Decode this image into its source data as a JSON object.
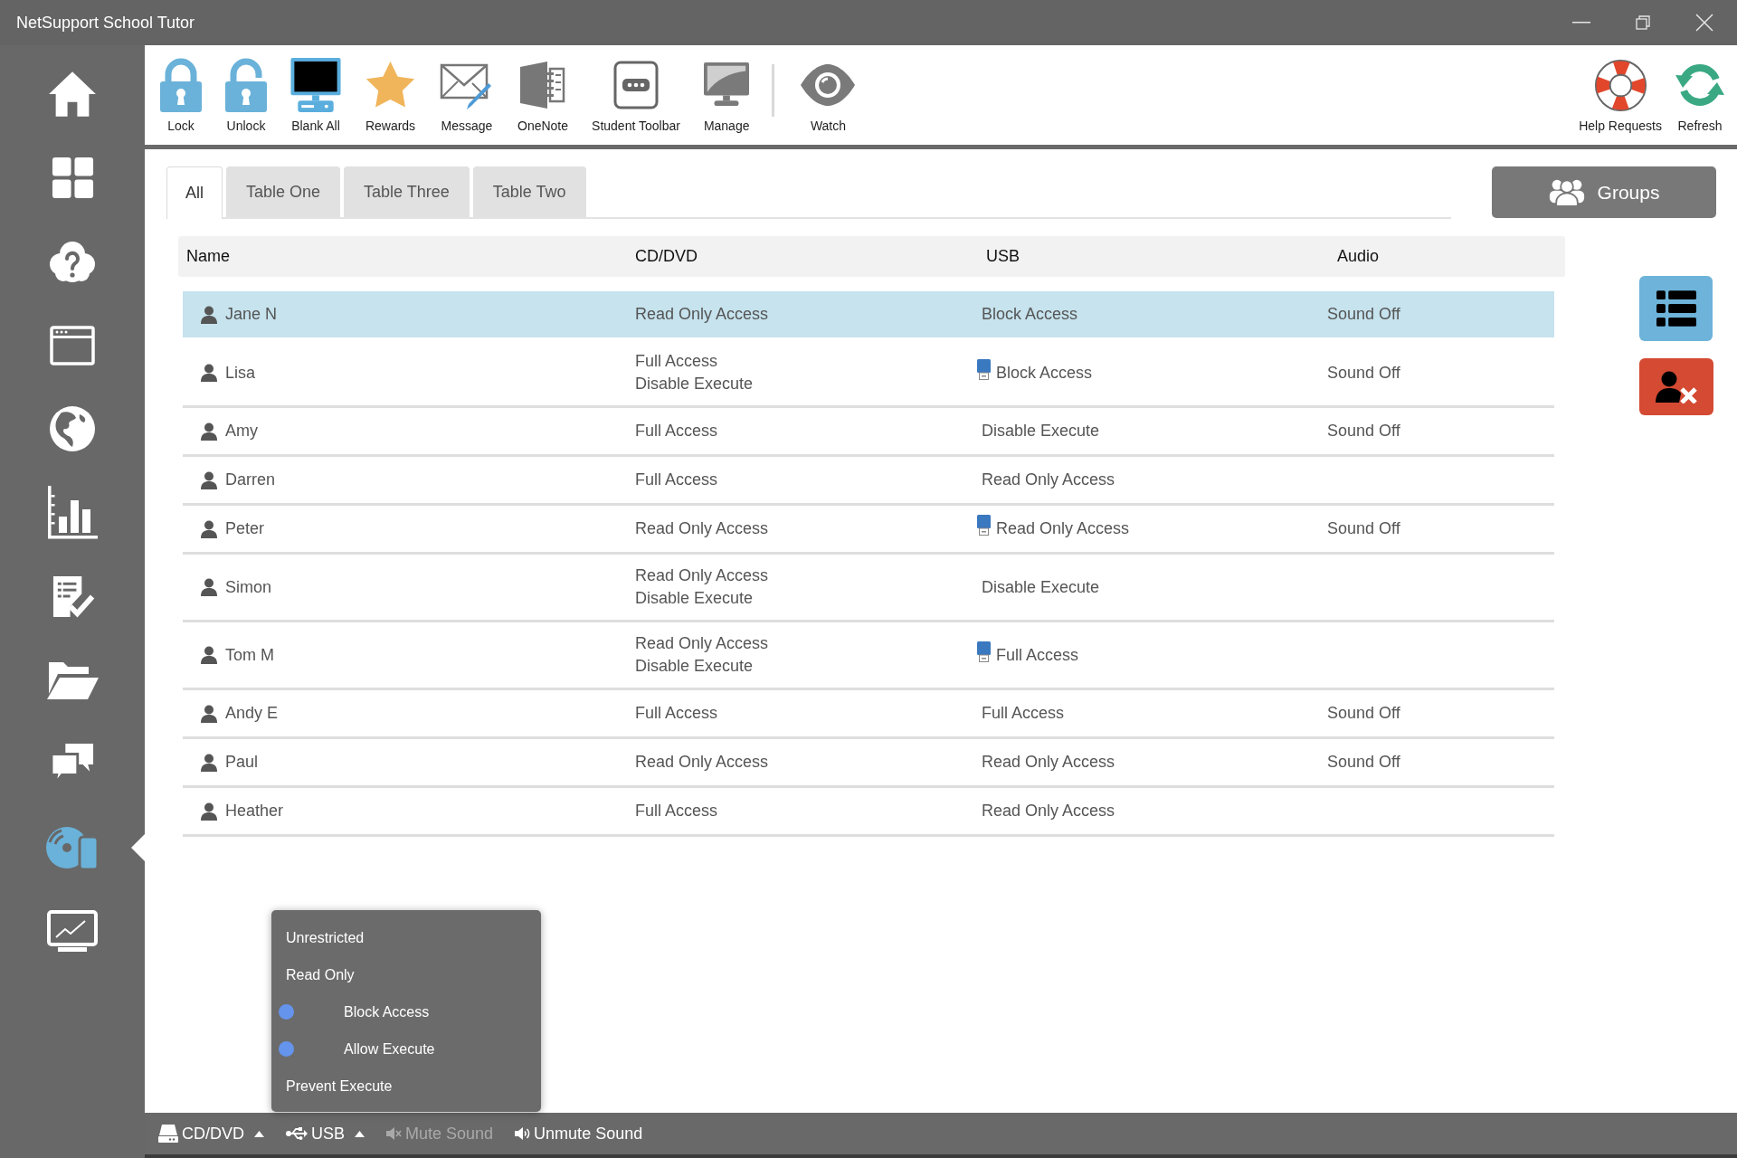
{
  "window": {
    "title": "NetSupport School Tutor"
  },
  "sidebar": {
    "items": [
      {
        "selected": false
      },
      {
        "selected": false
      },
      {
        "selected": false
      },
      {
        "selected": false
      },
      {
        "selected": false
      },
      {
        "selected": false
      },
      {
        "selected": false
      },
      {
        "selected": false
      },
      {
        "selected": false
      },
      {
        "selected": true
      },
      {
        "selected": false
      }
    ]
  },
  "toolbar": {
    "groups": [
      {
        "items": [
          {
            "label": "Lock"
          },
          {
            "label": "Unlock"
          },
          {
            "label": "Blank All"
          },
          {
            "label": "Rewards"
          },
          {
            "label": "Message"
          },
          {
            "label": "OneNote"
          },
          {
            "label": "Student Toolbar"
          },
          {
            "label": "Manage"
          }
        ]
      },
      {
        "items": [
          {
            "label": "Watch"
          }
        ]
      }
    ],
    "right_items": [
      {
        "label": "Help Requests"
      },
      {
        "label": "Refresh"
      }
    ]
  },
  "tabs": [
    {
      "label": "All",
      "selected": true
    },
    {
      "label": "Table One",
      "selected": false
    },
    {
      "label": "Table Three",
      "selected": false
    },
    {
      "label": "Table Two",
      "selected": false
    }
  ],
  "groups_button": {
    "label": "Groups"
  },
  "table": {
    "columns": [
      "Name",
      "CD/DVD",
      "USB",
      "Audio"
    ],
    "rows": [
      {
        "name": "Jane N",
        "selected": true,
        "cd_dvd": [
          "Read Only Access"
        ],
        "usb": "Block Access",
        "usb_device": false,
        "audio": "Sound Off"
      },
      {
        "name": "Lisa",
        "selected": false,
        "cd_dvd": [
          "Full Access",
          "Disable Execute"
        ],
        "usb": "Block Access",
        "usb_device": true,
        "audio": "Sound Off"
      },
      {
        "name": "Amy",
        "selected": false,
        "cd_dvd": [
          "Full Access"
        ],
        "usb": "Disable Execute",
        "usb_device": false,
        "audio": "Sound Off"
      },
      {
        "name": "Darren",
        "selected": false,
        "cd_dvd": [
          "Full Access"
        ],
        "usb": "Read Only Access",
        "usb_device": false
      },
      {
        "name": "Peter",
        "selected": false,
        "cd_dvd": [
          "Read Only Access"
        ],
        "usb": "Read Only Access",
        "usb_device": true,
        "audio": "Sound Off"
      },
      {
        "name": "Simon",
        "selected": false,
        "cd_dvd": [
          "Read Only Access",
          "Disable Execute"
        ],
        "usb": "Disable Execute",
        "usb_device": false
      },
      {
        "name": "Tom M",
        "selected": false,
        "cd_dvd": [
          "Read Only Access",
          "Disable Execute"
        ],
        "usb": "Full Access",
        "usb_device": true
      },
      {
        "name": "Andy E",
        "selected": false,
        "cd_dvd": [
          "Full Access"
        ],
        "usb": "Full Access",
        "usb_device": false,
        "audio": "Sound Off"
      },
      {
        "name": "Paul",
        "selected": false,
        "cd_dvd": [
          "Read Only Access"
        ],
        "usb": "Read Only Access",
        "usb_device": false,
        "audio": "Sound Off"
      },
      {
        "name": "Heather",
        "selected": false,
        "cd_dvd": [
          "Full Access"
        ],
        "usb": "Read Only Access",
        "usb_device": false
      }
    ]
  },
  "popup_menu": {
    "items": [
      {
        "label": "Unrestricted",
        "checked": false
      },
      {
        "label": "Read Only",
        "checked": false
      },
      {
        "label": "Block Access",
        "checked": true
      },
      {
        "label": "Allow Execute",
        "checked": true
      },
      {
        "label": "Prevent Execute",
        "checked": false
      }
    ]
  },
  "bottom_bar": {
    "items": [
      {
        "label": "CD/DVD",
        "kind": "menu",
        "disabled": false
      },
      {
        "label": "USB",
        "kind": "menu",
        "disabled": false
      },
      {
        "label": "Mute Sound",
        "kind": "action",
        "disabled": true
      },
      {
        "label": "Unmute Sound",
        "kind": "action",
        "disabled": false
      }
    ]
  }
}
